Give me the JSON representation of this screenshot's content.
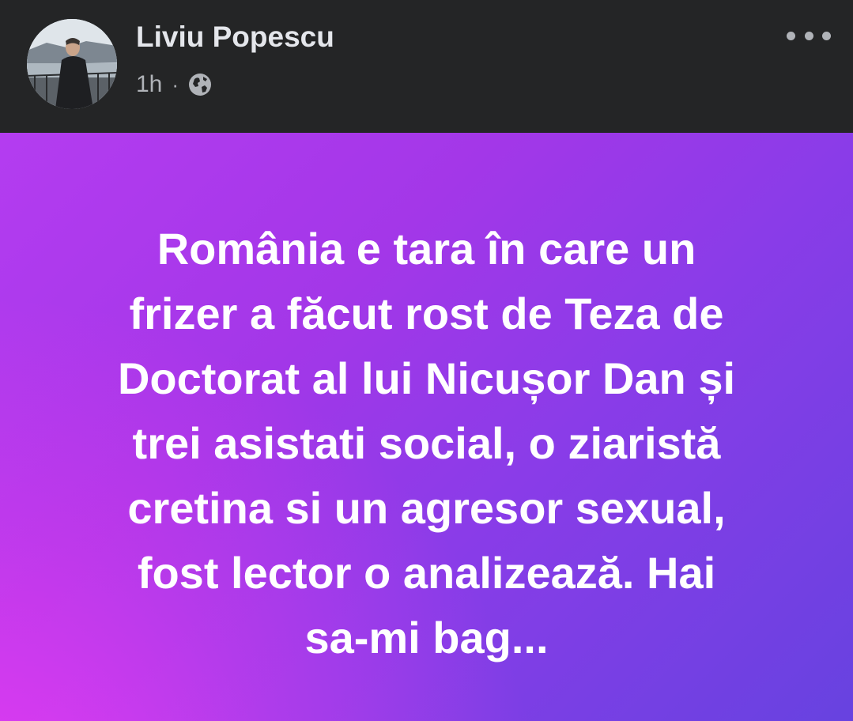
{
  "post": {
    "author": "Liviu Popescu",
    "time": "1h",
    "separator": "·",
    "audience_icon": "globe-icon",
    "menu_icon": "more-options-icon",
    "text_lines": [
      "România e tara în care un",
      "frizer a făcut rost de Teza de",
      "Doctorat al lui Nicușor Dan și",
      "trei asistati social, o ziaristă",
      "cretina si un agresor sexual,",
      "fost lector o analizează. Hai",
      "sa-mi bag..."
    ]
  },
  "colors": {
    "header_bg": "#242526",
    "name_color": "#e4e6eb",
    "meta_color": "#b0b3b8",
    "gradient_start": "#f83cf5",
    "gradient_end": "#6742e0",
    "text_color": "#ffffff"
  }
}
